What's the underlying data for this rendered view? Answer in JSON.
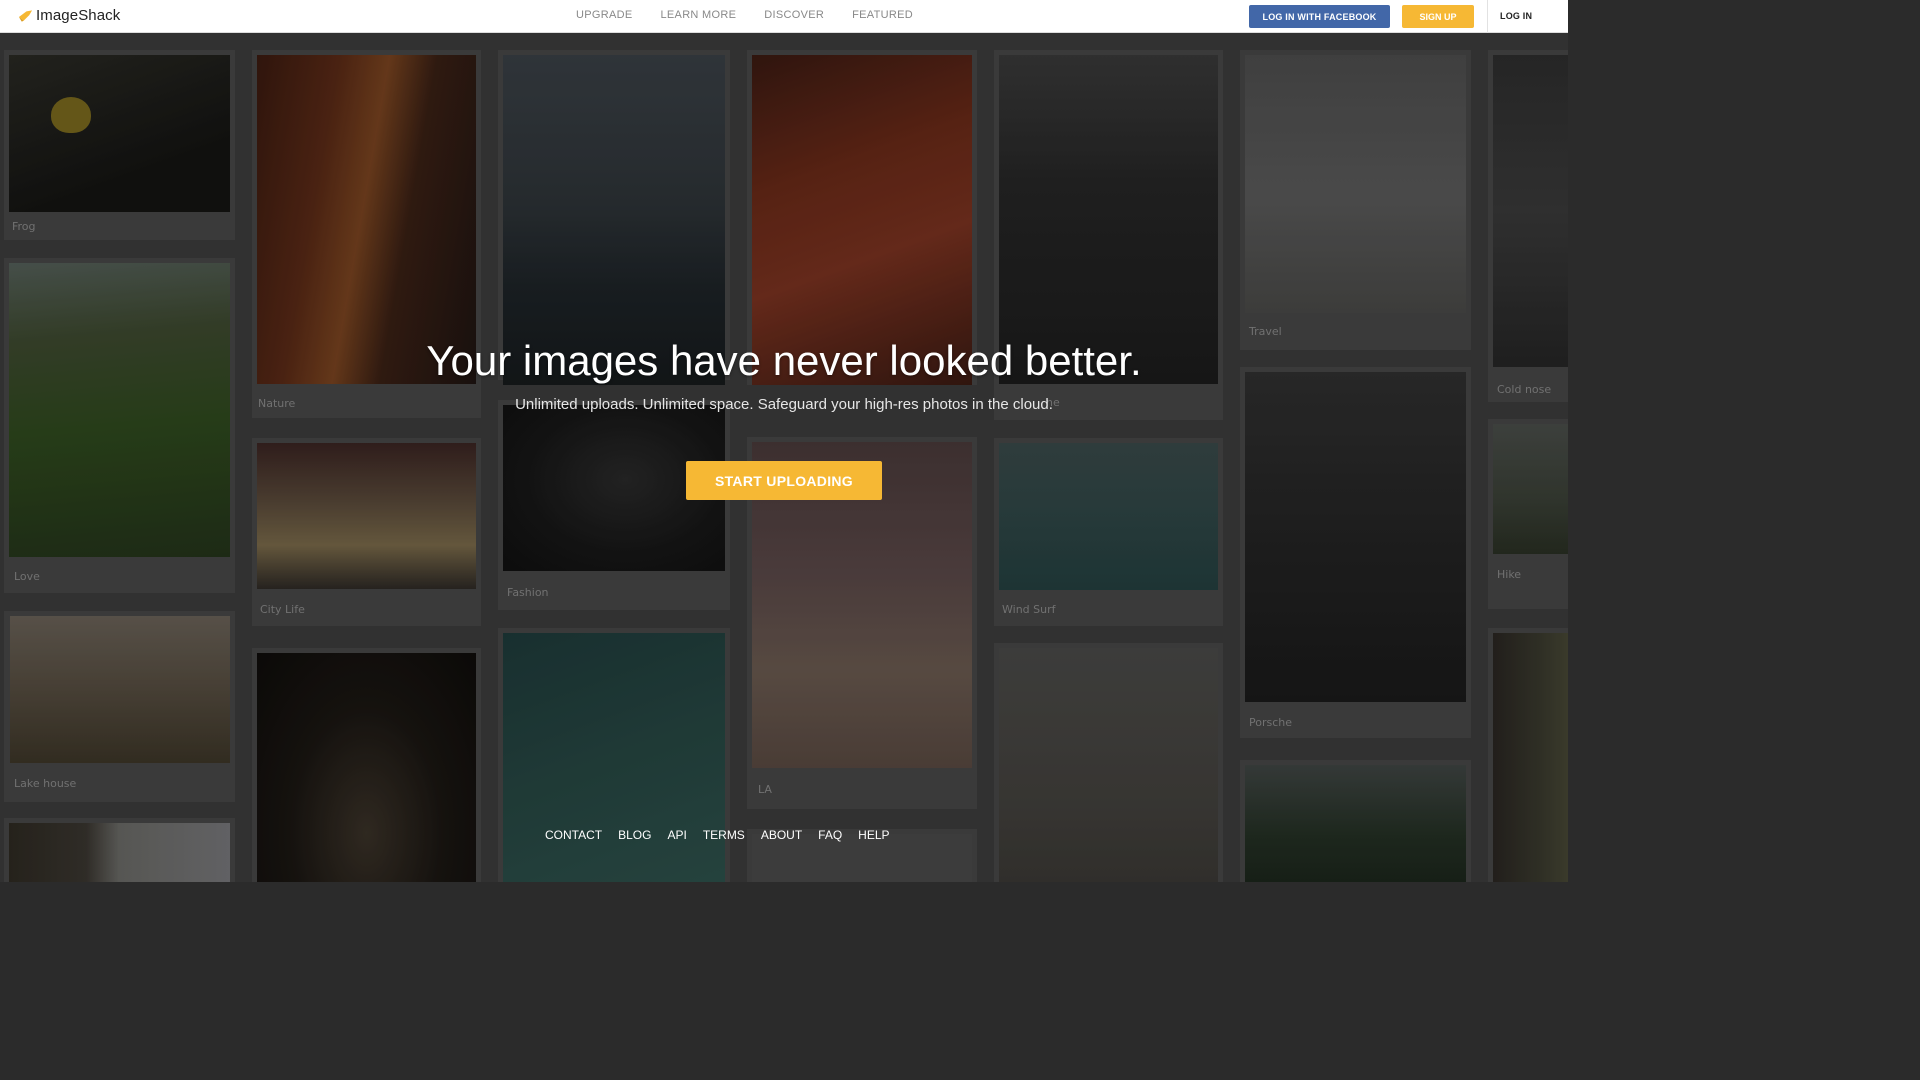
{
  "header": {
    "logo_text": "ImageShack",
    "nav": [
      "UPGRADE",
      "LEARN MORE",
      "DISCOVER",
      "FEATURED"
    ],
    "facebook_label": "LOG IN WITH FACEBOOK",
    "signup_label": "SIGN UP",
    "login_label": "LOG IN"
  },
  "hero": {
    "title": "Your images have never looked better.",
    "subtitle": "Unlimited uploads. Unlimited space. Safeguard your high-res photos in the cloud.",
    "cta_label": "START UPLOADING"
  },
  "gallery": {
    "captions": [
      "Frog",
      "Love",
      "Lake house",
      "Nature",
      "City Life",
      "Fashion",
      "LA",
      "Wind Surf",
      "Travel",
      "Porsche",
      "Cold nose",
      "Hike",
      "ne"
    ]
  },
  "footer": {
    "links": [
      "CONTACT",
      "BLOG",
      "API",
      "TERMS",
      "ABOUT",
      "FAQ",
      "HELP"
    ]
  },
  "colors": {
    "accent": "#f6b834",
    "facebook": "#4267a8"
  }
}
